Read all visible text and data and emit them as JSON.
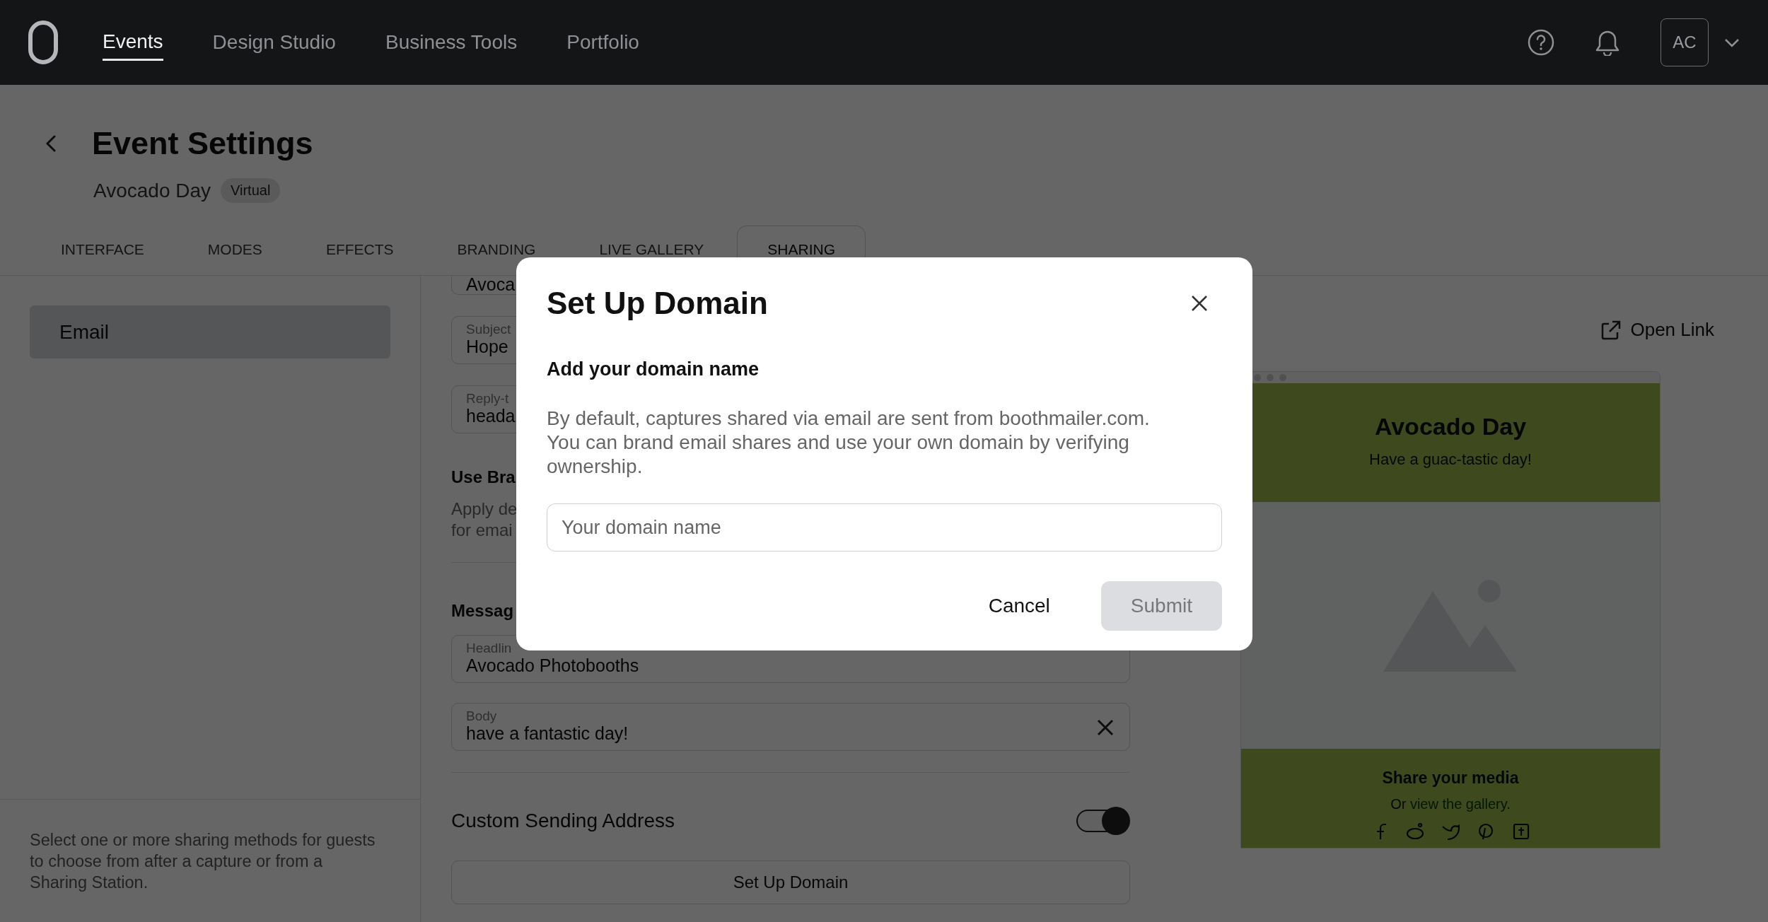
{
  "topbar": {
    "nav": [
      {
        "label": "Events",
        "selected": true
      },
      {
        "label": "Design Studio",
        "selected": false
      },
      {
        "label": "Business Tools",
        "selected": false
      },
      {
        "label": "Portfolio",
        "selected": false
      }
    ],
    "avatar": "AC"
  },
  "header": {
    "title": "Event Settings",
    "event_name": "Avocado Day",
    "badge": "Virtual"
  },
  "tabs": [
    {
      "label": "INTERFACE",
      "selected": false
    },
    {
      "label": "MODES",
      "selected": false
    },
    {
      "label": "EFFECTS",
      "selected": false
    },
    {
      "label": "BRANDING",
      "selected": false
    },
    {
      "label": "LIVE GALLERY",
      "selected": false
    },
    {
      "label": "SHARING",
      "selected": true
    }
  ],
  "sidebar": {
    "items": [
      {
        "label": "Email",
        "selected": true
      }
    ],
    "help_text": "Select one or more sharing methods for guests to choose from after a capture or from a Sharing Station."
  },
  "form": {
    "sender_fields": [
      {
        "value": "Avoca"
      },
      {
        "label": "Subject",
        "value": "Hope"
      },
      {
        "label": "Reply-t",
        "value": "heada"
      }
    ],
    "branding_heading": "Use Bra",
    "branding_description": [
      "Apply de",
      "for emai"
    ],
    "message_heading": "Messag",
    "message_fields": [
      {
        "label": "Headlin",
        "value": "Avocado Photobooths",
        "clearable": false
      },
      {
        "label": "Body",
        "value": "have a fantastic day!",
        "clearable": true
      }
    ],
    "custom_sending": {
      "label": "Custom Sending Address",
      "on": true
    },
    "setup_button": "Set Up Domain"
  },
  "preview": {
    "open_link": "Open Link",
    "title": "Avocado Day",
    "tagline": "Have a guac-tastic day!",
    "share_title": "Share your media",
    "share_prefix": "Or",
    "share_link": "view the gallery."
  },
  "modal": {
    "title": "Set Up Domain",
    "subtitle": "Add your domain name",
    "description": [
      "By default, captures shared via email are sent from boothmailer.com.",
      "You can brand email shares and use your own domain by verifying ownership."
    ],
    "input": {
      "placeholder": "Your domain name"
    },
    "buttons": [
      {
        "label": "Cancel",
        "kind": "secondary",
        "disabled": false
      },
      {
        "label": "Submit",
        "kind": "primary",
        "disabled": true
      }
    ]
  }
}
